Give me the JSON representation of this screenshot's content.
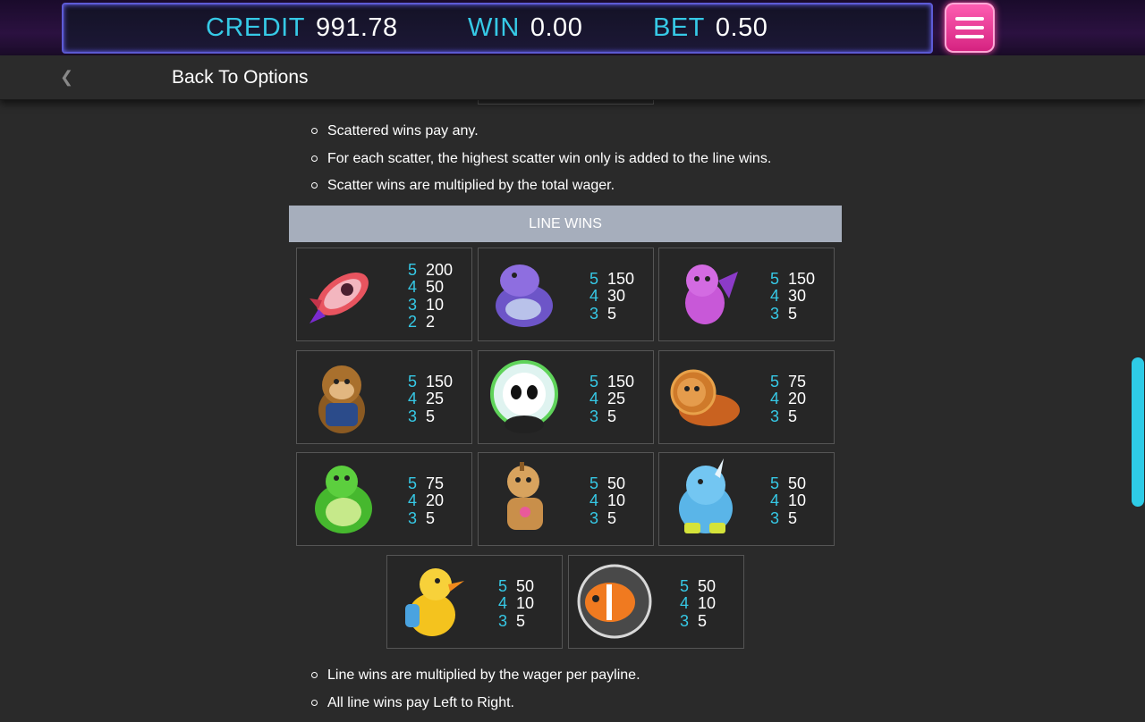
{
  "header": {
    "credit_label": "CREDIT",
    "credit_value": "991.78",
    "win_label": "WIN",
    "win_value": "0.00",
    "bet_label": "BET",
    "bet_value": "0.50",
    "menu_icon": "hamburger-icon"
  },
  "nav": {
    "back_icon": "chevron-left-icon",
    "back_label": "Back To Options"
  },
  "scatter_rules": [
    "Scattered wins pay any.",
    "For each scatter, the highest scatter win only is added to the line wins.",
    "Scatter wins are multiplied by the total wager."
  ],
  "line_wins": {
    "title": "LINE WINS",
    "symbols": [
      {
        "name": "rocket",
        "pays": [
          {
            "count": "5",
            "amount": "200"
          },
          {
            "count": "4",
            "amount": "50"
          },
          {
            "count": "3",
            "amount": "10"
          },
          {
            "count": "2",
            "amount": "2"
          }
        ]
      },
      {
        "name": "hippo",
        "pays": [
          {
            "count": "5",
            "amount": "150"
          },
          {
            "count": "4",
            "amount": "30"
          },
          {
            "count": "3",
            "amount": "5"
          }
        ]
      },
      {
        "name": "dragon",
        "pays": [
          {
            "count": "5",
            "amount": "150"
          },
          {
            "count": "4",
            "amount": "30"
          },
          {
            "count": "3",
            "amount": "5"
          }
        ]
      },
      {
        "name": "monkey",
        "pays": [
          {
            "count": "5",
            "amount": "150"
          },
          {
            "count": "4",
            "amount": "25"
          },
          {
            "count": "3",
            "amount": "5"
          }
        ]
      },
      {
        "name": "panda",
        "pays": [
          {
            "count": "5",
            "amount": "150"
          },
          {
            "count": "4",
            "amount": "25"
          },
          {
            "count": "3",
            "amount": "5"
          }
        ]
      },
      {
        "name": "lion",
        "pays": [
          {
            "count": "5",
            "amount": "75"
          },
          {
            "count": "4",
            "amount": "20"
          },
          {
            "count": "3",
            "amount": "5"
          }
        ]
      },
      {
        "name": "turtle",
        "pays": [
          {
            "count": "5",
            "amount": "75"
          },
          {
            "count": "4",
            "amount": "20"
          },
          {
            "count": "3",
            "amount": "5"
          }
        ]
      },
      {
        "name": "giraffe",
        "pays": [
          {
            "count": "5",
            "amount": "50"
          },
          {
            "count": "4",
            "amount": "10"
          },
          {
            "count": "3",
            "amount": "5"
          }
        ]
      },
      {
        "name": "rhino",
        "pays": [
          {
            "count": "5",
            "amount": "50"
          },
          {
            "count": "4",
            "amount": "10"
          },
          {
            "count": "3",
            "amount": "5"
          }
        ]
      },
      {
        "name": "duck",
        "pays": [
          {
            "count": "5",
            "amount": "50"
          },
          {
            "count": "4",
            "amount": "10"
          },
          {
            "count": "3",
            "amount": "5"
          }
        ]
      },
      {
        "name": "clownfish",
        "pays": [
          {
            "count": "5",
            "amount": "50"
          },
          {
            "count": "4",
            "amount": "10"
          },
          {
            "count": "3",
            "amount": "5"
          }
        ]
      }
    ]
  },
  "line_rules": [
    "Line wins are multiplied by the wager per payline.",
    "All line wins pay Left to Right."
  ],
  "colors": {
    "accent": "#36c9e6",
    "menu": "#e0308c",
    "header_band": "#a6aebc",
    "background": "#2a2a2a"
  }
}
